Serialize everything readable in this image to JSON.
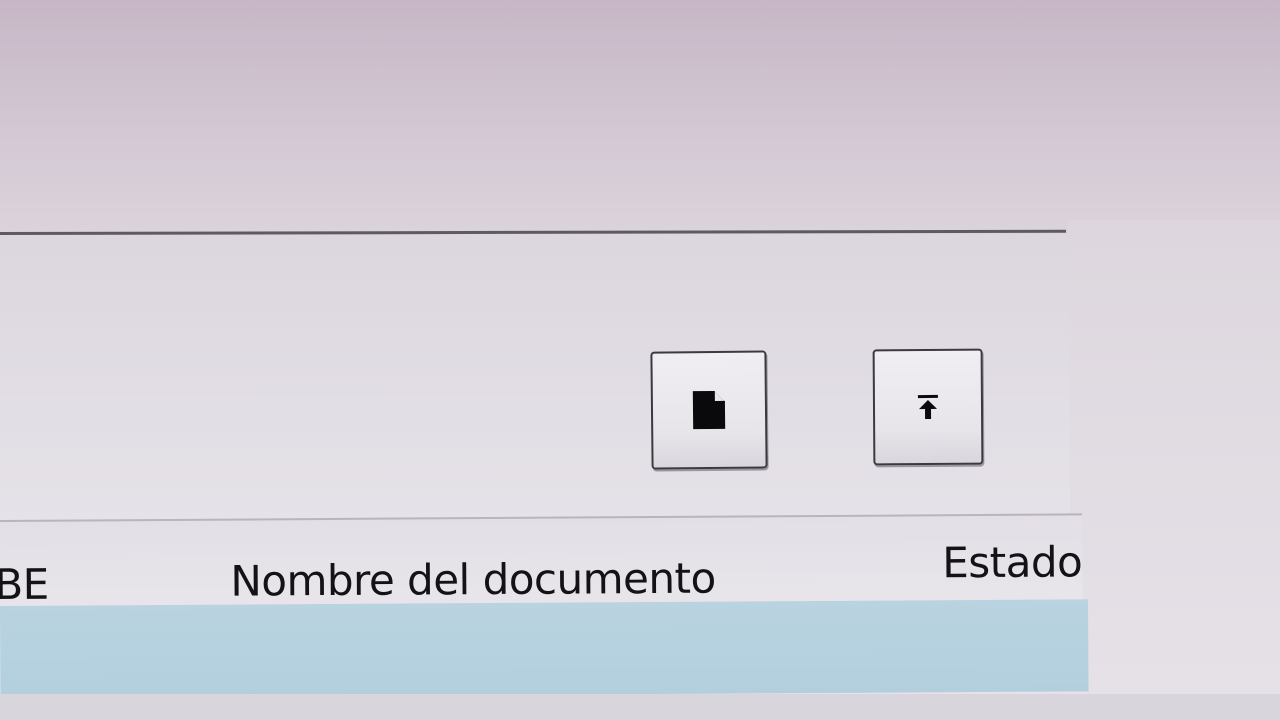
{
  "toolbar": {
    "new_document_icon": "document-icon",
    "upload_icon": "upload-arrow-icon"
  },
  "table": {
    "columns": [
      {
        "label": "BE"
      },
      {
        "label": "Nombre del documento"
      },
      {
        "label": "Estado"
      }
    ],
    "rows": [
      {
        "selected": true,
        "cells": []
      }
    ]
  },
  "colors": {
    "selected_row": "#b6d1df",
    "button_border": "#3c3a40",
    "panel_background": "#e2dee5"
  }
}
